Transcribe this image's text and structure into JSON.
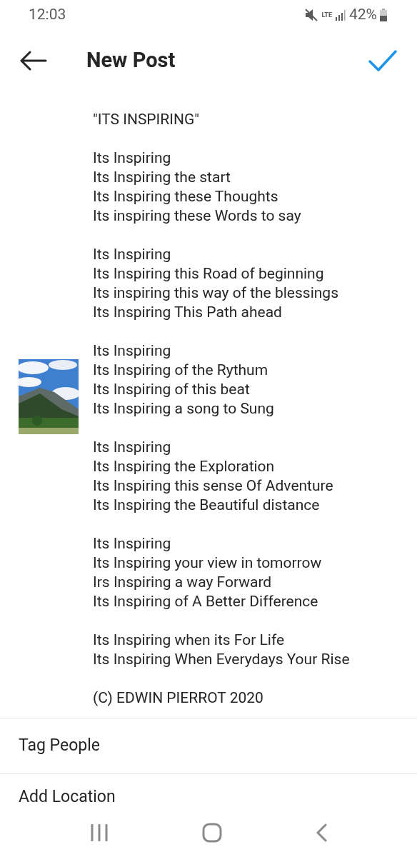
{
  "status_bar": {
    "time": "12:03",
    "network": "LTE",
    "battery": "42%"
  },
  "header": {
    "title": "New Post"
  },
  "caption": [
    "\"ITS INSPIRING\"",
    "Its Inspiring\nIts Inspiring the start\nIts Inspiring these Thoughts\nIts inspiring these Words to say",
    "Its Inspiring\nIts Inspiring this Road of beginning\nIts inspiring this way of the blessings\nIts Inspiring This Path ahead",
    "Its Inspiring\nIts Inspiring of the Rythum\nIts Inspiring of this beat\nIts Inspiring a song to Sung",
    "Its Inspiring\nIts Inspiring the Exploration\nIts Inspiring this sense Of Adventure\nIts Inspiring the Beautiful distance",
    "Its Inspiring\nIts Inspiring your view in tomorrow\nIrs Inspiring a way Forward\nIts Inspiring of A Better Difference",
    "Its Inspiring when its For Life\nIts Inspiring When Everydays Your Rise",
    "(C) EDWIN PIERROT 2020"
  ],
  "options": [
    {
      "label": "Tag People"
    },
    {
      "label": "Add Location"
    }
  ]
}
